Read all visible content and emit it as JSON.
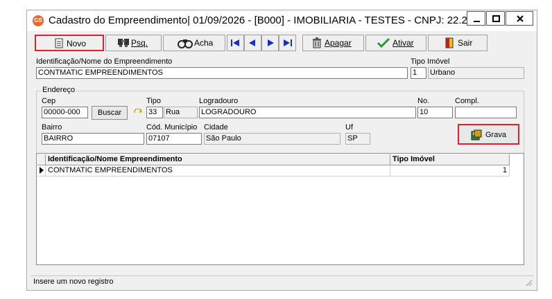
{
  "window": {
    "title": "Cadastro do Empreendimento|  01/09/2026 - [B000] - IMOBILIARIA - TESTES - CNPJ: 22.2...",
    "app_icon_text": "GS"
  },
  "toolbar": {
    "novo": "Novo",
    "psq": "Psq.",
    "acha": "Acha",
    "apagar": "Apagar",
    "ativar": "Ativar",
    "sair": "Sair"
  },
  "form": {
    "identificacao_label": "Identificação/Nome do Empreendimento",
    "identificacao_value": "CONTMATIC EMPREENDIMENTOS",
    "tipo_imovel_label": "Tipo Imóvel",
    "tipo_imovel_code": "1",
    "tipo_imovel_desc": "Urbano",
    "endereco_label": "Endereço",
    "cep_label": "Cep",
    "cep_value": "00000-000",
    "buscar_label": "Buscar",
    "tipo_label": "Tipo",
    "tipo_code": "33",
    "tipo_desc": "Rua",
    "logradouro_label": "Logradouro",
    "logradouro_value": "LOGRADOURO",
    "no_label": "No.",
    "no_value": "10",
    "compl_label": "Compl.",
    "compl_value": "",
    "bairro_label": "Bairro",
    "bairro_value": "BAIRRO",
    "cod_municipio_label": "Cód. Município",
    "cod_municipio_value": "07107",
    "cidade_label": "Cidade",
    "cidade_value": "São Paulo",
    "uf_label": "Uf",
    "uf_value": "SP",
    "grava_label": "Grava"
  },
  "grid": {
    "columns": [
      "Identificação/Nome Empreendimento",
      "Tipo Imóvel"
    ],
    "rows": [
      {
        "nome": "CONTMATIC EMPREENDIMENTOS",
        "tipo": "1"
      }
    ]
  },
  "status": {
    "text": "Insere um novo registro"
  },
  "colors": {
    "highlight": "#e0202a",
    "window_bg": "#f0f0f0"
  }
}
